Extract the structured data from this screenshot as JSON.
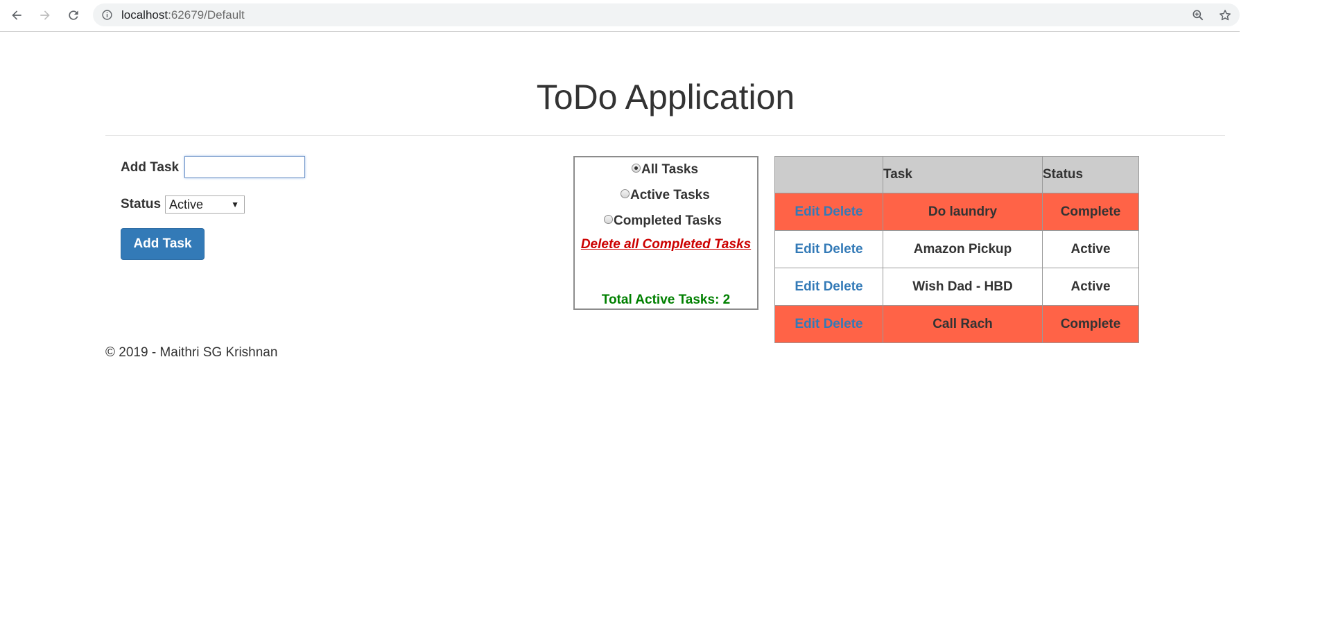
{
  "browser": {
    "url_host": "localhost",
    "url_path": ":62679/Default"
  },
  "page": {
    "title": "ToDo Application"
  },
  "form": {
    "add_task_label": "Add Task",
    "task_input_value": "",
    "status_label": "Status",
    "status_selected": "Active",
    "add_button_label": "Add Task"
  },
  "filters": {
    "options": [
      {
        "label": "All Tasks",
        "checked": true
      },
      {
        "label": "Active Tasks",
        "checked": false
      },
      {
        "label": "Completed Tasks",
        "checked": false
      }
    ],
    "delete_completed_label": "Delete all Completed Tasks",
    "total_active_label": "Total Active Tasks: 2"
  },
  "table": {
    "headers": [
      "",
      "Task",
      "Status"
    ],
    "rows": [
      {
        "edit": "Edit",
        "delete": "Delete",
        "task": "Do laundry",
        "status": "Complete"
      },
      {
        "edit": "Edit",
        "delete": "Delete",
        "task": "Amazon Pickup",
        "status": "Active"
      },
      {
        "edit": "Edit",
        "delete": "Delete",
        "task": "Wish Dad - HBD",
        "status": "Active"
      },
      {
        "edit": "Edit",
        "delete": "Delete",
        "task": "Call Rach",
        "status": "Complete"
      }
    ]
  },
  "footer": {
    "text": "© 2019 - Maithri SG Krishnan"
  },
  "colors": {
    "complete_row": "#ff6347",
    "primary_button": "#337ab7",
    "delete_link": "#cc0000",
    "total_active": "#008000"
  },
  "icons": {
    "back": "arrow-left-icon",
    "forward": "arrow-right-icon",
    "reload": "reload-icon",
    "site_info": "info-icon",
    "zoom": "zoom-icon",
    "bookmark": "star-icon"
  }
}
